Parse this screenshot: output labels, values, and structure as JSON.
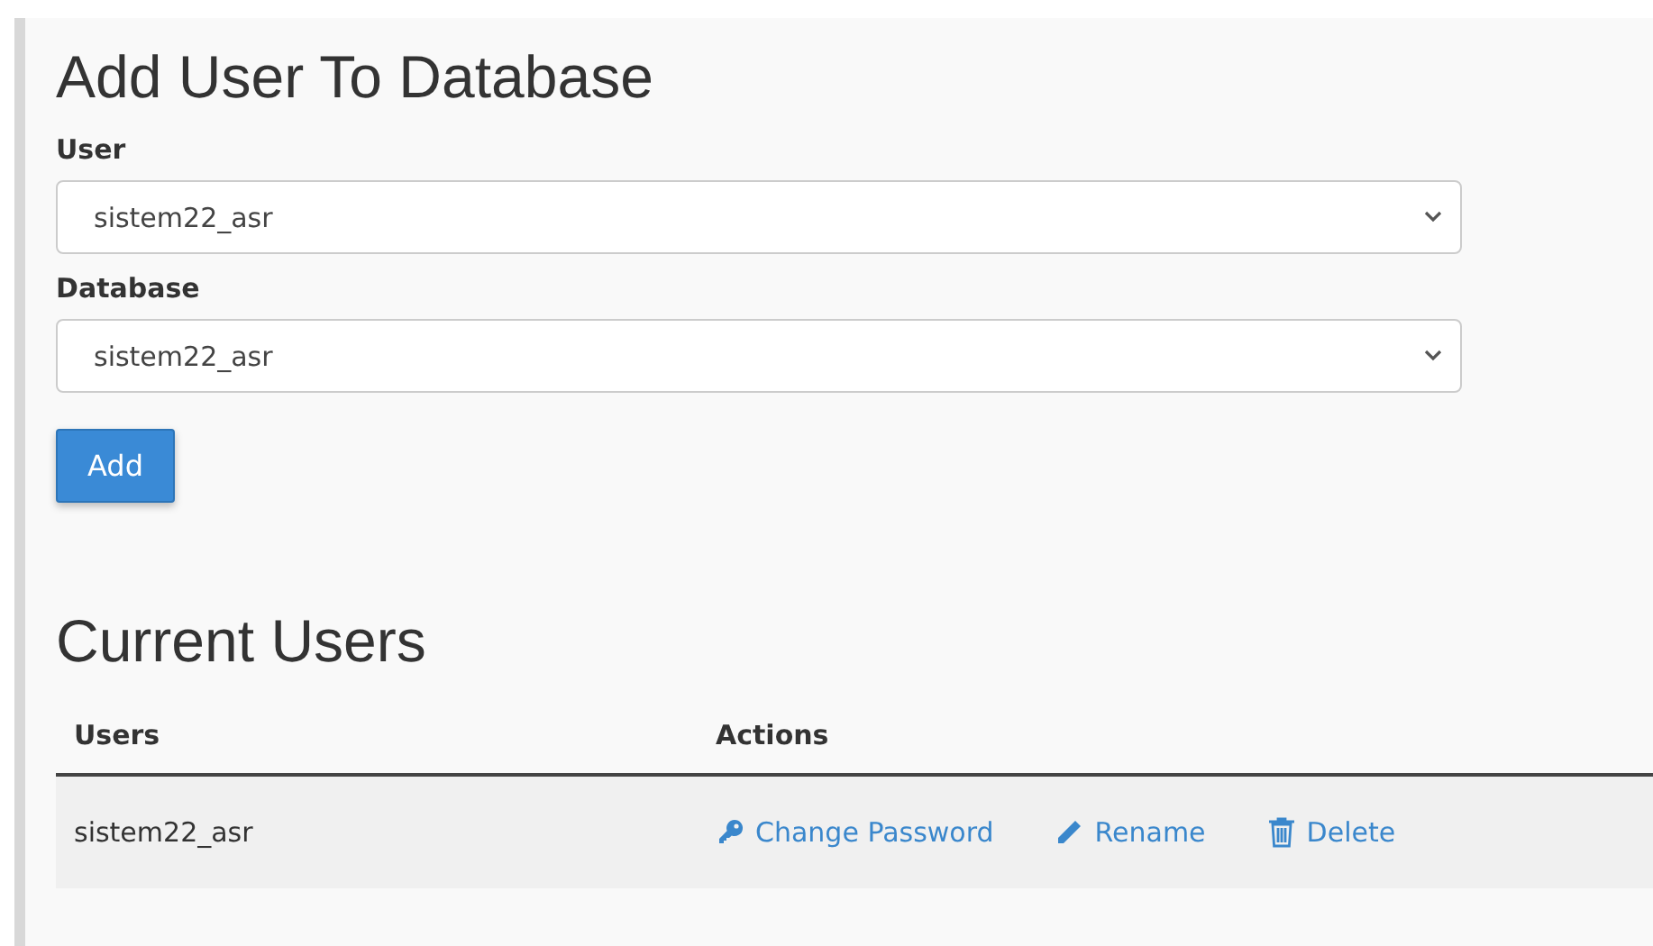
{
  "add_section": {
    "title": "Add User To Database",
    "fields": [
      {
        "label": "User",
        "value": "sistem22_asr"
      },
      {
        "label": "Database",
        "value": "sistem22_asr"
      }
    ],
    "button": "Add"
  },
  "users_section": {
    "title": "Current Users",
    "table": {
      "columns": [
        "Users",
        "Actions"
      ],
      "rows": [
        {
          "user": "sistem22_asr",
          "actions": [
            {
              "kind": "key",
              "label": "Change Password"
            },
            {
              "kind": "pencil",
              "label": "Rename"
            },
            {
              "kind": "trash",
              "label": "Delete"
            }
          ]
        }
      ]
    }
  }
}
